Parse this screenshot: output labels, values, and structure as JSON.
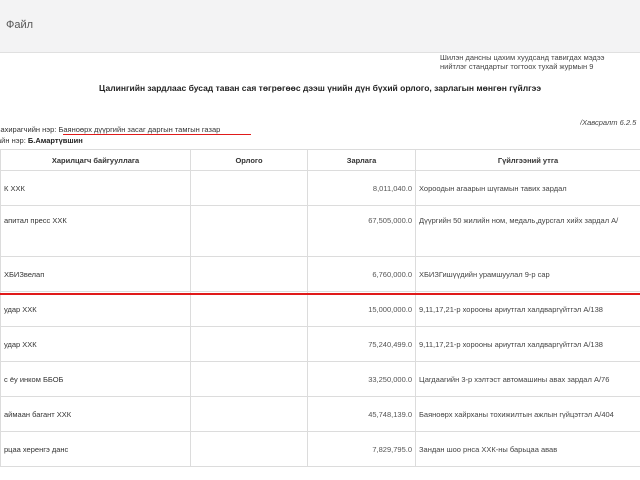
{
  "app": {
    "file_menu": "Файл"
  },
  "document": {
    "top_note": [
      "Шилэн дансны цахим хуудсанд тавигдах мэдээ",
      "нийтлэг стандартыг тогтоох тухай журмын 9"
    ],
    "title": "Цалингийн зардлаас бусад таван сая төгрөгөөс дээш үнийн дүн бүхий орлого, зарлагын мөнгөн гүйлгээ",
    "appendix": "/Хавсралт 6.2.5",
    "org_label": "захирагчийн нэр:",
    "org_name": "Баяноөрх дүүргийн засаг даргын тамгын газар",
    "accountant_label": "айн нэр:",
    "accountant_name": "Б.Амартүвшин"
  },
  "table": {
    "headers": [
      "Харилцагч байгууллага",
      "Орлого",
      "Зарлага",
      "Гүйлгээний утга"
    ],
    "rows": [
      {
        "partner": "К ХХК",
        "income": "",
        "expense": "8,011,040.0",
        "purpose": "Хороодын агаарын шүгамын тавих зардал"
      },
      {
        "partner": "апитал пресс ХХК",
        "income": "",
        "expense": "67,505,000.0",
        "purpose": "Дүүргийн 50 жилийн ном, медаль,дурсгал хийх зардал А/"
      },
      {
        "partner": "ХБИЗвелап",
        "income": "",
        "expense": "6,760,000.0",
        "purpose": "ХБИЗГишүүдийн урамшуулал 9-р сар"
      },
      {
        "partner": "удар ХХК",
        "income": "",
        "expense": "15,000,000.0",
        "purpose": "9,11,17,21-р хорооны ариутгал халдваргүйтгэл А/138"
      },
      {
        "partner": "удар ХХК",
        "income": "",
        "expense": "75,240,499.0",
        "purpose": "9,11,17,21-р хорооны ариутгал халдваргүйтгэл А/138"
      },
      {
        "partner": "с ёу инком ББОБ",
        "income": "",
        "expense": "33,250,000.0",
        "purpose": "Цагдаагийн 3-р хэлтэст автомашины авах зардал А/76"
      },
      {
        "partner": "аймаан багант ХХК",
        "income": "",
        "expense": "45,748,139.0",
        "purpose": "Баяноөрх хайрханы тохижилтын ажлын гүйцэтгэл А/404"
      },
      {
        "partner": "рцаа херенгэ данс",
        "income": "",
        "expense": "7,829,795.0",
        "purpose": "Зандан шоо рнса ХХК-ны барьцаа авав"
      }
    ]
  },
  "colors": {
    "annotation_red": "#e01a1a"
  }
}
